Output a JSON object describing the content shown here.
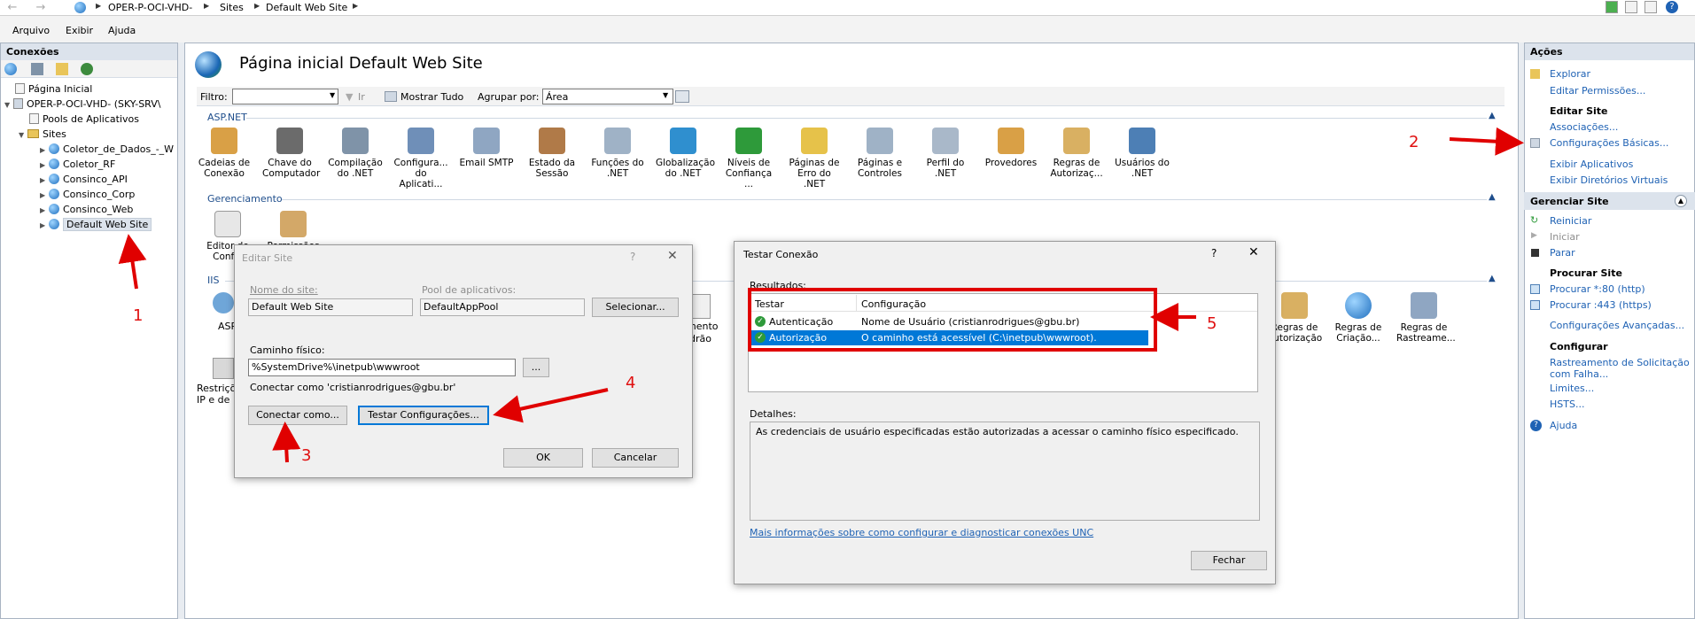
{
  "nav": {
    "breadcrumb": [
      "OPER-P-OCI-VHD-",
      "Sites",
      "Default Web Site"
    ]
  },
  "menu": {
    "items": [
      "Arquivo",
      "Exibir",
      "Ajuda"
    ]
  },
  "connections": {
    "title": "Conexões",
    "tree": {
      "home": "Página Inicial",
      "server": "OPER-P-OCI-VHD- (SKY-SRV\\",
      "pools": "Pools de Aplicativos",
      "sites": "Sites",
      "site_list": [
        "Coletor_de_Dados_-_W",
        "Coletor_RF",
        "Consinco_API",
        "Consinco_Corp",
        "Consinco_Web",
        "Default Web Site"
      ]
    }
  },
  "center": {
    "title": "Página inicial Default Web Site",
    "filter": {
      "label": "Filtro:",
      "show_all": "Mostrar Tudo",
      "group_label": "Agrupar por:",
      "group_value": "Área",
      "go": "Ir"
    },
    "sections": [
      "ASP.NET",
      "Gerenciamento",
      "IIS"
    ],
    "aspnet_features": [
      "Cadeias de Conexão",
      "Chave do Computador",
      "Compilação do .NET",
      "Configura... do Aplicati...",
      "Email SMTP",
      "Estado da Sessão",
      "Funções do .NET",
      "Globalização do .NET",
      "Níveis de Confiança ...",
      "Páginas de Erro do .NET",
      "Páginas e Controles",
      "Perfil do .NET",
      "Provedores",
      "Regras de Autorizaç...",
      "Usuários do .NET"
    ],
    "mgmt_features": [
      "Editor de Config",
      "Permissões"
    ],
    "iis_partial": {
      "asp": "ASP",
      "restrict": "Restriçõ IP e de",
      "mento": "mento",
      "dirao": "drão",
      "auth": "Regras de Autorização",
      "create": "Regras de Criação...",
      "trace": "Regras de Rastreame..."
    }
  },
  "edit_site": {
    "title": "Editar Site",
    "help": "?",
    "close": "✕",
    "site_name_label": "Nome do site:",
    "site_name": "Default Web Site",
    "pool_label": "Pool de aplicativos:",
    "pool": "DefaultAppPool",
    "select": "Selecionar...",
    "path_label": "Caminho físico:",
    "path": "%SystemDrive%\\inetpub\\wwwroot",
    "browse": "...",
    "connect_as_text": "Conectar como 'cristianrodrigues@gbu.br'",
    "connect_as_btn": "Conectar como...",
    "test_btn": "Testar Configurações...",
    "ok": "OK",
    "cancel": "Cancelar"
  },
  "test_conn": {
    "title": "Testar Conexão",
    "help": "?",
    "close": "✕",
    "results_label": "Resultados:",
    "col_test": "Testar",
    "col_config": "Configuração",
    "rows": [
      {
        "test": "Autenticação",
        "config": "Nome de Usuário (cristianrodrigues@gbu.br)"
      },
      {
        "test": "Autorização",
        "config": "O caminho está acessível (C:\\inetpub\\wwwroot)."
      }
    ],
    "details_label": "Detalhes:",
    "details": "As credenciais de usuário especificadas estão autorizadas a acessar o caminho físico especificado.",
    "more_link": "Mais informações sobre como configurar e diagnosticar conexões UNC",
    "close_btn": "Fechar"
  },
  "actions": {
    "title": "Ações",
    "explore": "Explorar",
    "edit_perms": "Editar Permissões...",
    "edit_site_h": "Editar Site",
    "bindings": "Associações...",
    "basic": "Configurações Básicas...",
    "view_apps": "Exibir Aplicativos",
    "view_vdirs": "Exibir Diretórios Virtuais",
    "manage_h": "Gerenciar Site",
    "restart": "Reiniciar",
    "start": "Iniciar",
    "stop": "Parar",
    "browse_h": "Procurar Site",
    "browse80": "Procurar *:80 (http)",
    "browse443": "Procurar :443 (https)",
    "advanced": "Configurações Avançadas...",
    "configure_h": "Configurar",
    "failed": "Rastreamento de Solicitação",
    "failed2": "com Falha...",
    "limits": "Limites...",
    "hsts": "HSTS...",
    "help": "Ajuda"
  },
  "annotations": [
    "1",
    "2",
    "3",
    "4",
    "5"
  ],
  "colors": {
    "accent": "#0078d7",
    "annotation": "#e00000",
    "link": "#1f62b4"
  }
}
